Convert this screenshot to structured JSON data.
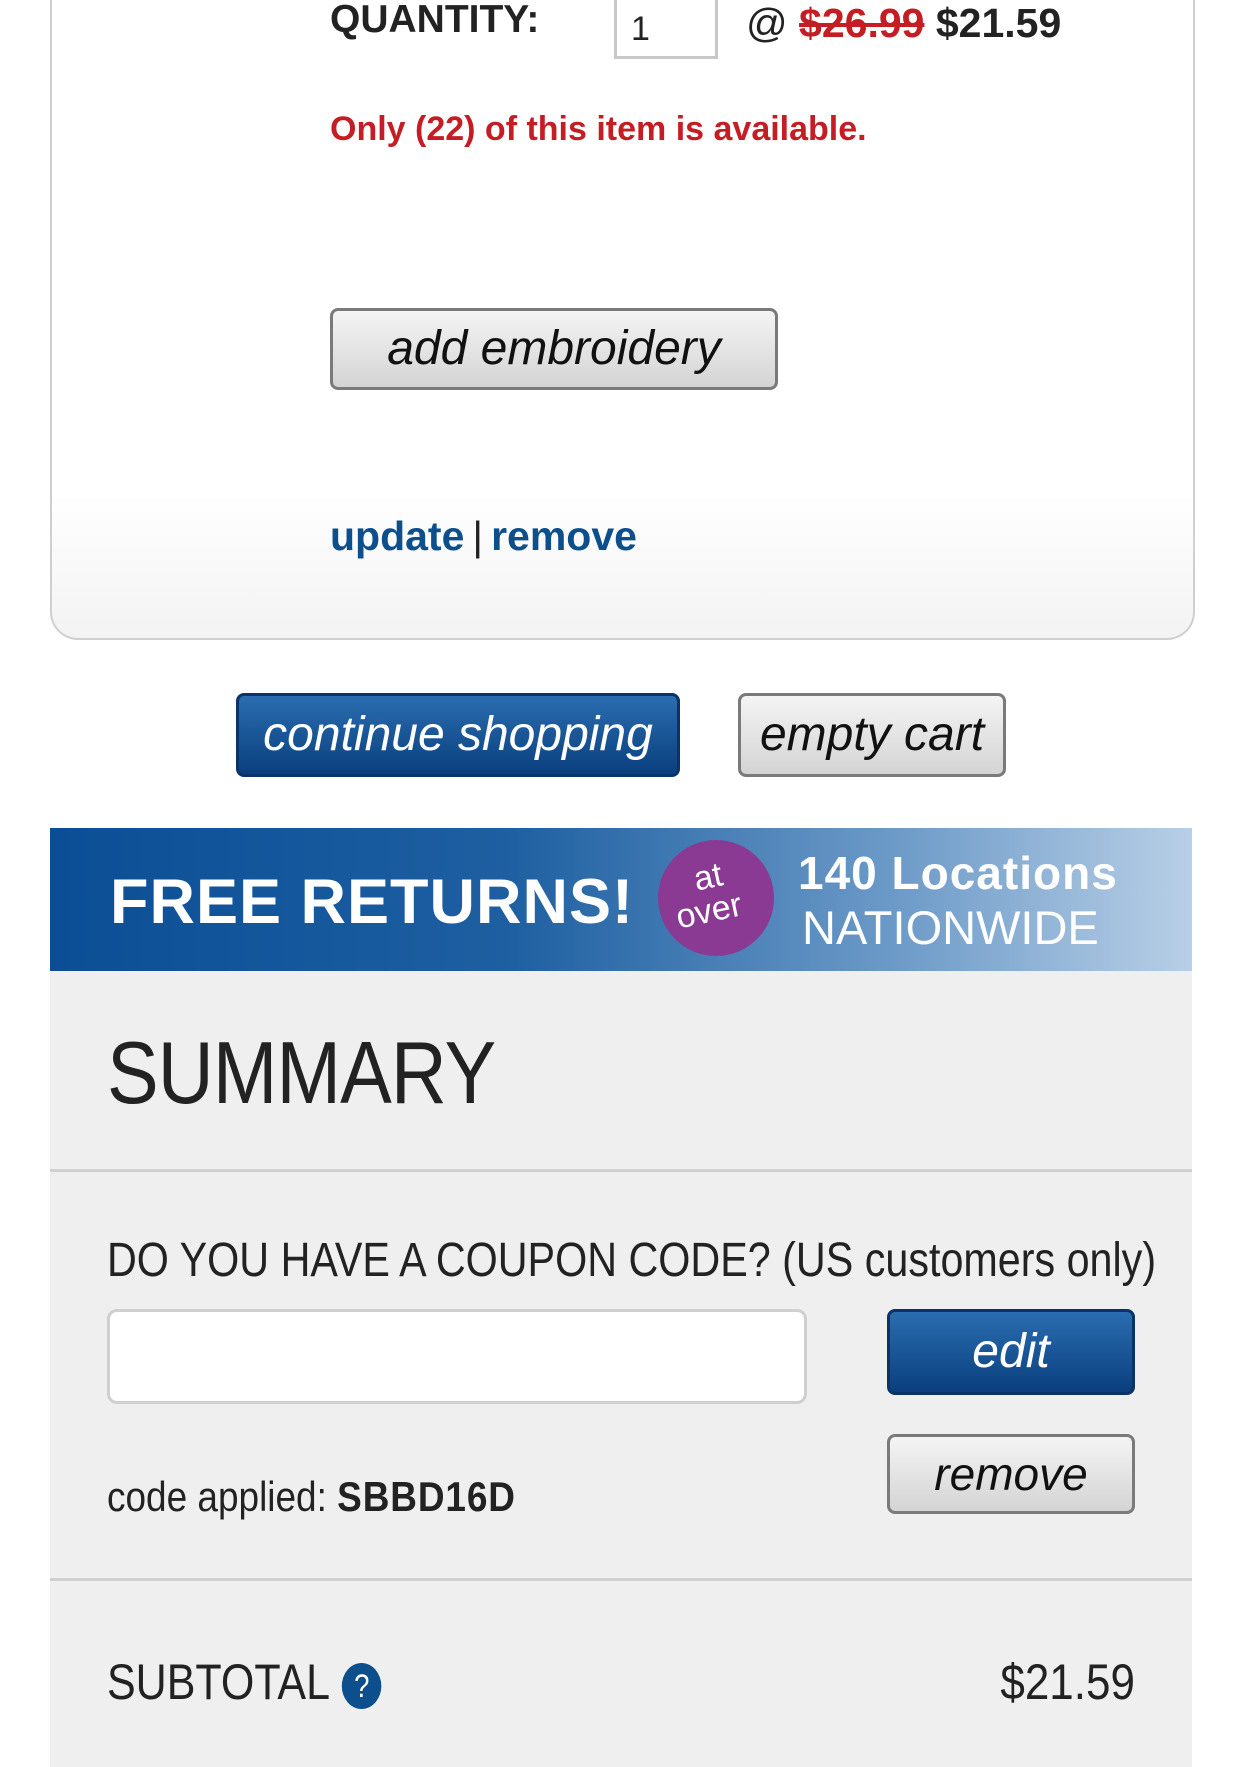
{
  "item": {
    "quantity_label": "QUANTITY:",
    "quantity_value": "1",
    "price_at": "@",
    "price_original": "$26.99",
    "price_sale": "$21.59",
    "stock_message": "Only (22) of this item is available.",
    "add_embroidery_label": "add embroidery",
    "update_label": "update",
    "separator": "|",
    "remove_label": "remove"
  },
  "cart_actions": {
    "continue_label": "continue shopping",
    "empty_label": "empty cart"
  },
  "banner": {
    "title": "FREE RETURNS!",
    "circle_top": "at",
    "circle_bottom": "over",
    "locations": "140 Locations",
    "nationwide": "NATIONWIDE"
  },
  "summary": {
    "title": "SUMMARY",
    "coupon_question": "DO YOU HAVE A COUPON CODE? (US customers only)",
    "coupon_input_value": "",
    "edit_label": "edit",
    "remove_label": "remove",
    "code_applied_label": "code applied:",
    "code_applied_value": "SBBD16D",
    "subtotal_label": "SUBTOTAL",
    "help_icon_glyph": "?",
    "subtotal_value": "$21.59"
  },
  "colors": {
    "accent_blue": "#0c4f8c",
    "sale_red": "#c41e24",
    "banner_purple": "#8a3a93"
  }
}
